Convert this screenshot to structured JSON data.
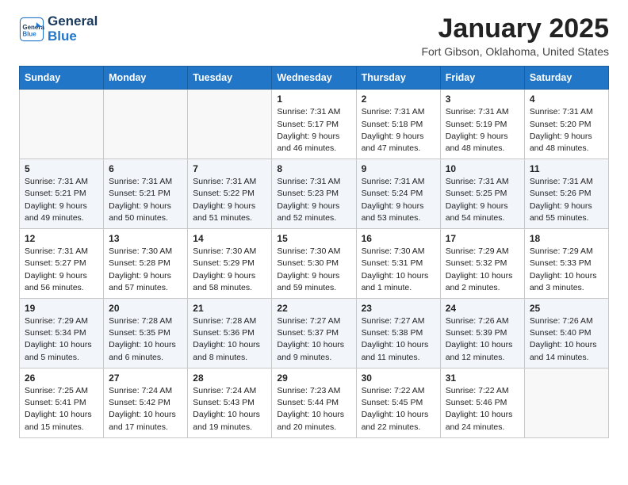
{
  "header": {
    "logo_line1": "General",
    "logo_line2": "Blue",
    "month": "January 2025",
    "location": "Fort Gibson, Oklahoma, United States"
  },
  "weekdays": [
    "Sunday",
    "Monday",
    "Tuesday",
    "Wednesday",
    "Thursday",
    "Friday",
    "Saturday"
  ],
  "weeks": [
    [
      {
        "day": "",
        "info": ""
      },
      {
        "day": "",
        "info": ""
      },
      {
        "day": "",
        "info": ""
      },
      {
        "day": "1",
        "info": "Sunrise: 7:31 AM\nSunset: 5:17 PM\nDaylight: 9 hours\nand 46 minutes."
      },
      {
        "day": "2",
        "info": "Sunrise: 7:31 AM\nSunset: 5:18 PM\nDaylight: 9 hours\nand 47 minutes."
      },
      {
        "day": "3",
        "info": "Sunrise: 7:31 AM\nSunset: 5:19 PM\nDaylight: 9 hours\nand 48 minutes."
      },
      {
        "day": "4",
        "info": "Sunrise: 7:31 AM\nSunset: 5:20 PM\nDaylight: 9 hours\nand 48 minutes."
      }
    ],
    [
      {
        "day": "5",
        "info": "Sunrise: 7:31 AM\nSunset: 5:21 PM\nDaylight: 9 hours\nand 49 minutes."
      },
      {
        "day": "6",
        "info": "Sunrise: 7:31 AM\nSunset: 5:21 PM\nDaylight: 9 hours\nand 50 minutes."
      },
      {
        "day": "7",
        "info": "Sunrise: 7:31 AM\nSunset: 5:22 PM\nDaylight: 9 hours\nand 51 minutes."
      },
      {
        "day": "8",
        "info": "Sunrise: 7:31 AM\nSunset: 5:23 PM\nDaylight: 9 hours\nand 52 minutes."
      },
      {
        "day": "9",
        "info": "Sunrise: 7:31 AM\nSunset: 5:24 PM\nDaylight: 9 hours\nand 53 minutes."
      },
      {
        "day": "10",
        "info": "Sunrise: 7:31 AM\nSunset: 5:25 PM\nDaylight: 9 hours\nand 54 minutes."
      },
      {
        "day": "11",
        "info": "Sunrise: 7:31 AM\nSunset: 5:26 PM\nDaylight: 9 hours\nand 55 minutes."
      }
    ],
    [
      {
        "day": "12",
        "info": "Sunrise: 7:31 AM\nSunset: 5:27 PM\nDaylight: 9 hours\nand 56 minutes."
      },
      {
        "day": "13",
        "info": "Sunrise: 7:30 AM\nSunset: 5:28 PM\nDaylight: 9 hours\nand 57 minutes."
      },
      {
        "day": "14",
        "info": "Sunrise: 7:30 AM\nSunset: 5:29 PM\nDaylight: 9 hours\nand 58 minutes."
      },
      {
        "day": "15",
        "info": "Sunrise: 7:30 AM\nSunset: 5:30 PM\nDaylight: 9 hours\nand 59 minutes."
      },
      {
        "day": "16",
        "info": "Sunrise: 7:30 AM\nSunset: 5:31 PM\nDaylight: 10 hours\nand 1 minute."
      },
      {
        "day": "17",
        "info": "Sunrise: 7:29 AM\nSunset: 5:32 PM\nDaylight: 10 hours\nand 2 minutes."
      },
      {
        "day": "18",
        "info": "Sunrise: 7:29 AM\nSunset: 5:33 PM\nDaylight: 10 hours\nand 3 minutes."
      }
    ],
    [
      {
        "day": "19",
        "info": "Sunrise: 7:29 AM\nSunset: 5:34 PM\nDaylight: 10 hours\nand 5 minutes."
      },
      {
        "day": "20",
        "info": "Sunrise: 7:28 AM\nSunset: 5:35 PM\nDaylight: 10 hours\nand 6 minutes."
      },
      {
        "day": "21",
        "info": "Sunrise: 7:28 AM\nSunset: 5:36 PM\nDaylight: 10 hours\nand 8 minutes."
      },
      {
        "day": "22",
        "info": "Sunrise: 7:27 AM\nSunset: 5:37 PM\nDaylight: 10 hours\nand 9 minutes."
      },
      {
        "day": "23",
        "info": "Sunrise: 7:27 AM\nSunset: 5:38 PM\nDaylight: 10 hours\nand 11 minutes."
      },
      {
        "day": "24",
        "info": "Sunrise: 7:26 AM\nSunset: 5:39 PM\nDaylight: 10 hours\nand 12 minutes."
      },
      {
        "day": "25",
        "info": "Sunrise: 7:26 AM\nSunset: 5:40 PM\nDaylight: 10 hours\nand 14 minutes."
      }
    ],
    [
      {
        "day": "26",
        "info": "Sunrise: 7:25 AM\nSunset: 5:41 PM\nDaylight: 10 hours\nand 15 minutes."
      },
      {
        "day": "27",
        "info": "Sunrise: 7:24 AM\nSunset: 5:42 PM\nDaylight: 10 hours\nand 17 minutes."
      },
      {
        "day": "28",
        "info": "Sunrise: 7:24 AM\nSunset: 5:43 PM\nDaylight: 10 hours\nand 19 minutes."
      },
      {
        "day": "29",
        "info": "Sunrise: 7:23 AM\nSunset: 5:44 PM\nDaylight: 10 hours\nand 20 minutes."
      },
      {
        "day": "30",
        "info": "Sunrise: 7:22 AM\nSunset: 5:45 PM\nDaylight: 10 hours\nand 22 minutes."
      },
      {
        "day": "31",
        "info": "Sunrise: 7:22 AM\nSunset: 5:46 PM\nDaylight: 10 hours\nand 24 minutes."
      },
      {
        "day": "",
        "info": ""
      }
    ]
  ]
}
